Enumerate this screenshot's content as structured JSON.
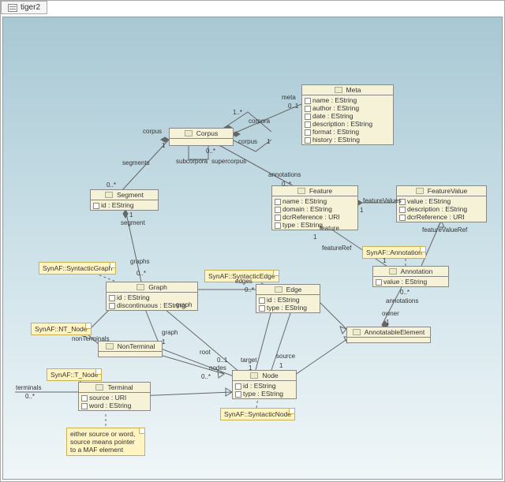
{
  "tab_label": "tiger2",
  "classes": {
    "meta": {
      "title": "Meta",
      "attrs": [
        "name : EString",
        "author : EString",
        "date : EString",
        "description : EString",
        "format : EString",
        "history : EString"
      ]
    },
    "corpus": {
      "title": "Corpus",
      "attrs": []
    },
    "segment": {
      "title": "Segment",
      "attrs": [
        "id : EString"
      ]
    },
    "feature": {
      "title": "Feature",
      "attrs": [
        "name : EString",
        "domain : EString",
        "dcrReference : URI",
        "type : EString"
      ]
    },
    "featurevalue": {
      "title": "FeatureValue",
      "attrs": [
        "value : EString",
        "description : EString",
        "dcrReference : URI"
      ]
    },
    "annotation": {
      "title": "Annotation",
      "attrs": [
        "value : EString"
      ]
    },
    "graph": {
      "title": "Graph",
      "attrs": [
        "id : EString",
        "discontinuous : EString"
      ]
    },
    "edge": {
      "title": "Edge",
      "attrs": [
        "id : EString",
        "type : EString"
      ]
    },
    "nonterminal": {
      "title": "NonTerminal",
      "attrs": []
    },
    "terminal": {
      "title": "Terminal",
      "attrs": [
        "source : URI",
        "word : EString"
      ]
    },
    "node": {
      "title": "Node",
      "attrs": [
        "id : EString",
        "type : EString"
      ]
    },
    "annotatable": {
      "title": "AnnotatableElement",
      "attrs": []
    }
  },
  "notes": {
    "synaf_graph": "SynAF::SyntacticGraph",
    "synaf_ntnode": "SynAF::NT_Node",
    "synaf_tnode": "SynAF::T_Node",
    "synaf_edge": "SynAF::SyntacticEdge",
    "synaf_annot": "SynAF::Annotation",
    "synaf_node": "SynAF::SyntacticNode",
    "terminal_note": "either source or word, source means pointer to a MAF element"
  },
  "labels": {
    "meta": "meta",
    "m01": "0..1",
    "corpora": "corpora",
    "c1s": "1..*",
    "corpus_one": "corpus",
    "one": "1",
    "subcorpora": "subcorpora",
    "zs": "0..*",
    "supercorpus": "supercorpus",
    "segments": "segments",
    "annotations": "annotations",
    "segment": "segment",
    "graphs": "graphs",
    "graph": "graph",
    "edges": "edges",
    "nonterminals": "nonTerminals",
    "terminals": "terminals",
    "nodes": "nodes",
    "root": "root",
    "r01": "0..1",
    "target": "target",
    "source": "source",
    "owner": "owner",
    "annotations2": "annotations",
    "feature": "feature",
    "featureRef": "featureRef",
    "featureValues": "featureValues",
    "featureValueRef": "featureValueRef"
  }
}
